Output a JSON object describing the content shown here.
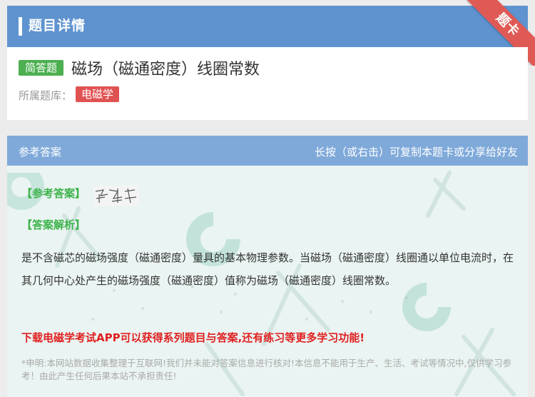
{
  "header": {
    "title": "题目详情",
    "ribbon": "题卡"
  },
  "question": {
    "type": "简答题",
    "title": "磁场（磁通密度）线圈常数",
    "library_label": "所属题库：",
    "library": "电磁学"
  },
  "answer_header": {
    "left": "参考答案",
    "right": "长按（或右击）可复制本题卡或分享给好友"
  },
  "answer": {
    "ref_label": "参考答案",
    "analysis_label": "答案解析",
    "explanation": "是不含磁芯的磁场强度（磁通密度）量具的基本物理参数。当磁场（磁通密度）线圈通以单位电流时，在其几何中心处产生的磁场强度（磁通密度）值称为磁场（磁通密度）线圈常数。",
    "promo": "下载电磁学考试APP可以获得系列题目与答案,还有练习等更多学习功能!",
    "disclaimer": "*申明:本网站数据收集整理于互联网!我们并未能对答案信息进行核对!本信息不能用于生产、生活、考试等情况中,仅供学习参考！由此产生任何后果本站不承担责任!"
  },
  "colors": {
    "header": "#5e93cf",
    "answer_header": "#7fa9d9",
    "answer_body": "#eaf4f2",
    "type_badge": "#4caf50",
    "library_badge": "#e05252",
    "ribbon": "#e05a55",
    "promo": "#e02020",
    "section": "#3cb34a"
  }
}
